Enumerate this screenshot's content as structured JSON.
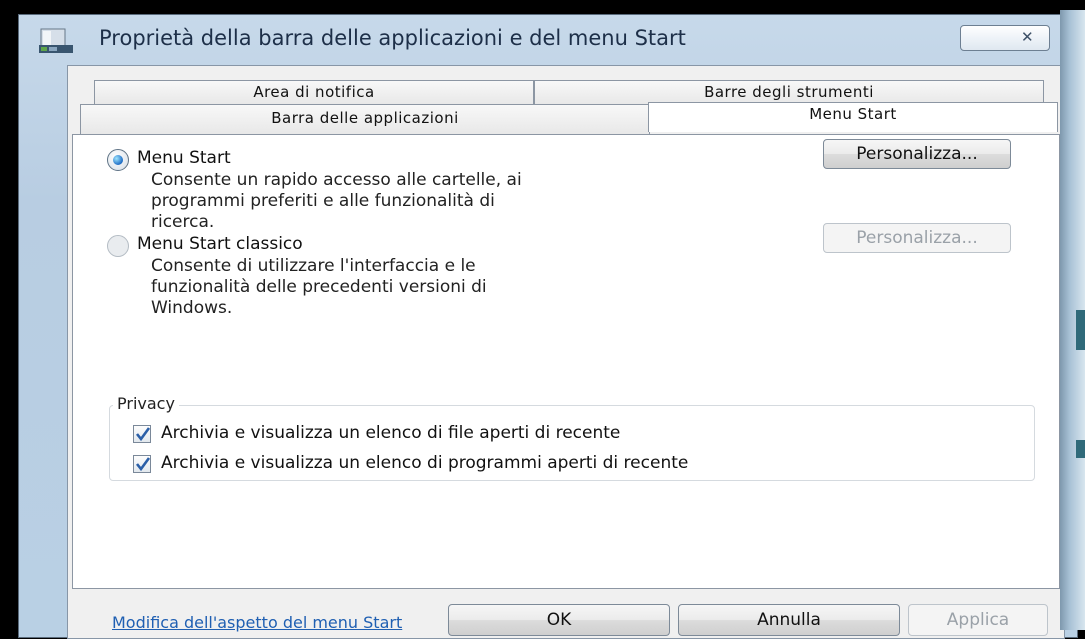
{
  "window": {
    "title": "Proprietà della barra delle applicazioni e del menu Start",
    "close_symbol": "✕"
  },
  "tabs": [
    {
      "label": "Area di notifica"
    },
    {
      "label": "Barre degli strumenti"
    },
    {
      "label": "Barra delle applicazioni"
    },
    {
      "label": "Menu Start",
      "active": true
    }
  ],
  "start_menu": {
    "selected": "menu_start",
    "option_start": {
      "label": "Menu Start",
      "description_lines": [
        "Consente un rapido accesso alle cartelle, ai",
        "programmi preferiti e alle funzionalità di",
        "ricerca."
      ],
      "button": "Personalizza..."
    },
    "option_classic": {
      "label": "Menu Start classico",
      "description_lines": [
        "Consente di utilizzare l'interfaccia e le",
        "funzionalità delle precedenti versioni di",
        "Windows."
      ],
      "button": "Personalizza..."
    }
  },
  "privacy": {
    "title": "Privacy",
    "items": [
      {
        "label": "Archivia e visualizza un elenco di file aperti di recente",
        "checked": true
      },
      {
        "label": "Archivia e visualizza un elenco di programmi aperti di recente",
        "checked": true
      }
    ]
  },
  "link": "Modifica dell'aspetto del menu Start",
  "footer": {
    "ok": "OK",
    "cancel": "Annulla",
    "apply": "Applica"
  },
  "colors": {
    "link": "#1f5fb2",
    "radio_accent": "#1d6cc5",
    "check_accent": "#2b5fa8"
  }
}
